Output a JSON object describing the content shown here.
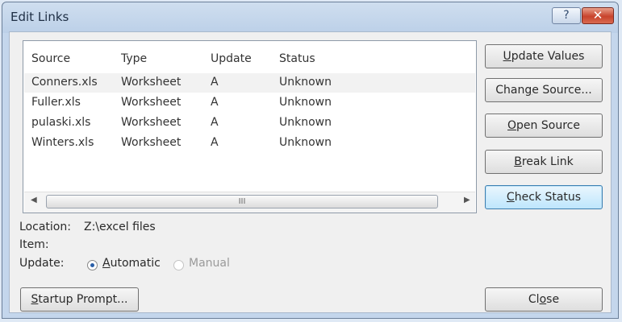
{
  "window": {
    "title": "Edit Links",
    "help_label": "?",
    "close_label": "✕"
  },
  "list": {
    "columns": [
      "Source",
      "Type",
      "Update",
      "Status"
    ],
    "rows": [
      {
        "source": "Conners.xls",
        "type": "Worksheet",
        "update": "A",
        "status": "Unknown"
      },
      {
        "source": "Fuller.xls",
        "type": "Worksheet",
        "update": "A",
        "status": "Unknown"
      },
      {
        "source": "pulaski.xls",
        "type": "Worksheet",
        "update": "A",
        "status": "Unknown"
      },
      {
        "source": "Winters.xls",
        "type": "Worksheet",
        "update": "A",
        "status": "Unknown"
      }
    ],
    "scroll": {
      "left": "◀",
      "right": "▶",
      "grip": "III"
    }
  },
  "buttons": {
    "update_values": {
      "a": "",
      "u": "U",
      "b": "pdate Values"
    },
    "change_source": {
      "a": "Chan",
      "u": "g",
      "b": "e Source..."
    },
    "open_source": {
      "a": "",
      "u": "O",
      "b": "pen Source"
    },
    "break_link": {
      "a": "",
      "u": "B",
      "b": "reak Link"
    },
    "check_status": {
      "a": "",
      "u": "C",
      "b": "heck Status"
    },
    "startup_prompt": {
      "a": "",
      "u": "S",
      "b": "tartup Prompt..."
    },
    "close": {
      "a": "Cl",
      "u": "o",
      "b": "se"
    }
  },
  "details": {
    "location_label": "Location:",
    "location_value": "Z:\\excel files",
    "item_label": "Item:",
    "update_label": "Update:",
    "automatic": {
      "a": "",
      "u": "A",
      "b": "utomatic"
    },
    "manual_label": "Manual"
  }
}
